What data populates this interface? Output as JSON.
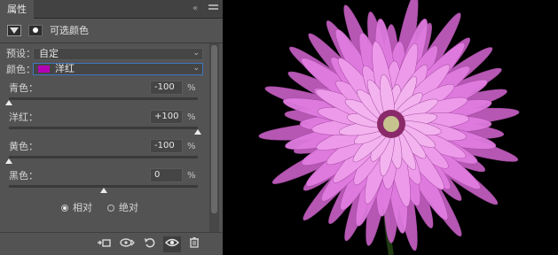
{
  "panel": {
    "tab_label": "属性",
    "collapse_glyph": "«",
    "header_title": "可选颜色",
    "preset": {
      "label": "预设：",
      "value": "自定"
    },
    "colors": {
      "label": "颜色：",
      "value": "洋红",
      "swatch_color": "#b400b4"
    },
    "sliders": [
      {
        "label": "青色：",
        "value": "-100",
        "unit": "%",
        "level": -100
      },
      {
        "label": "洋红：",
        "value": "+100",
        "unit": "%",
        "level": 100
      },
      {
        "label": "黄色：",
        "value": "-100",
        "unit": "%",
        "level": -100
      },
      {
        "label": "黑色：",
        "value": "0",
        "unit": "%",
        "level": 0
      }
    ],
    "method": {
      "relative_label": "相对",
      "absolute_label": "绝对",
      "selected": "relative"
    },
    "footer_icons": [
      "clip-to-layer-icon",
      "view-previous-state-icon",
      "reset-icon",
      "visibility-icon",
      "delete-icon"
    ]
  },
  "image": {
    "subject": "flower-photo",
    "background": "#000000",
    "petal_color": "#e07be0"
  }
}
